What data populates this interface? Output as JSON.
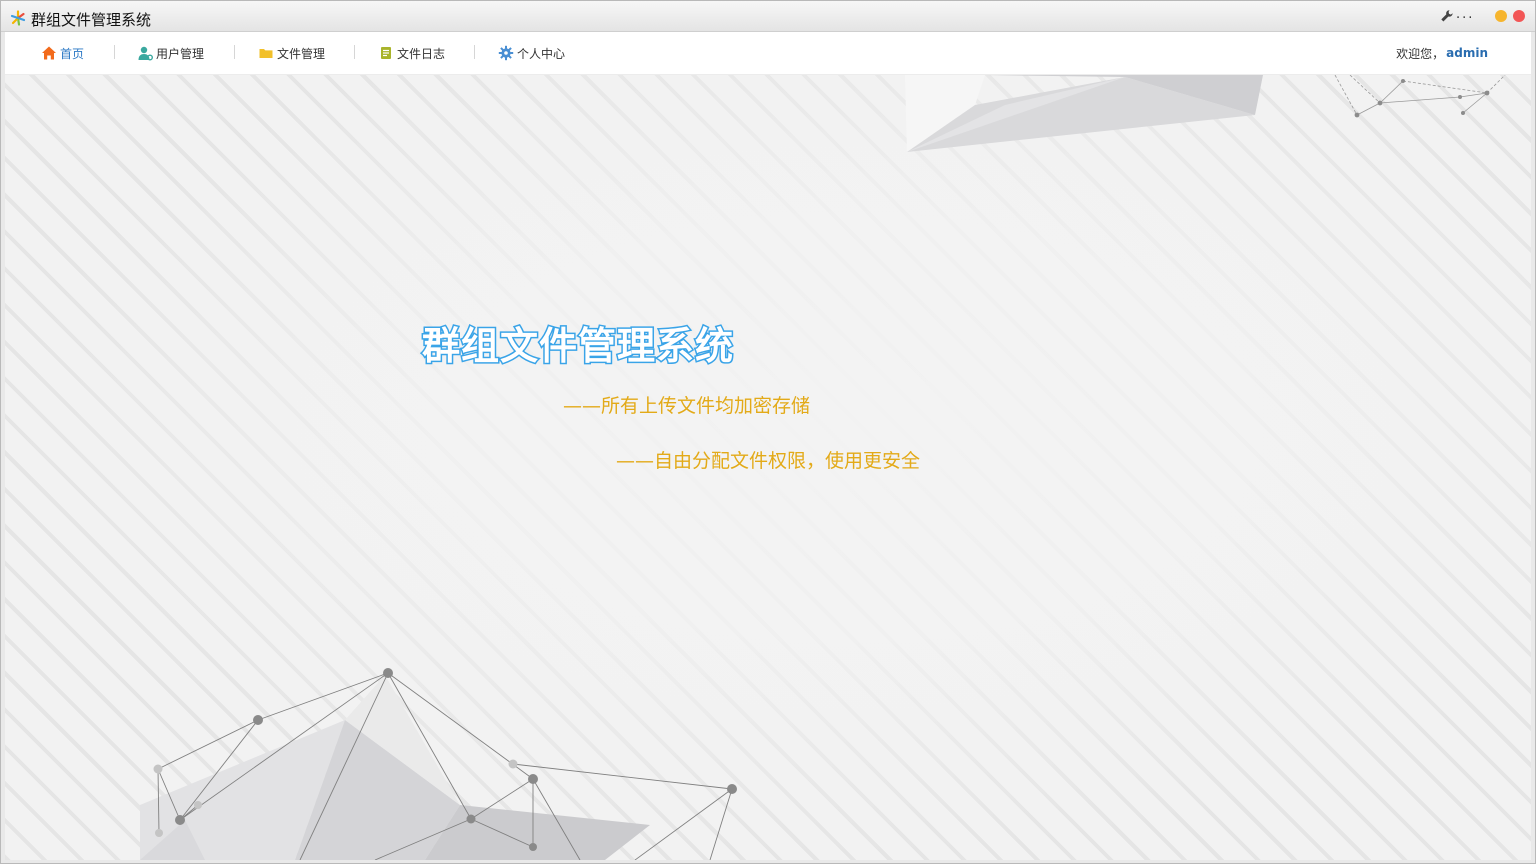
{
  "window": {
    "title": "群组文件管理系统",
    "more_label": "...",
    "app_icon": "pinwheel-icon",
    "controls": {
      "minimize_color": "#f6b52e",
      "close_color": "#f25656"
    }
  },
  "nav": {
    "items": [
      {
        "label": "首页",
        "icon": "home-icon",
        "active": true
      },
      {
        "label": "用户管理",
        "icon": "user-icon",
        "active": false
      },
      {
        "label": "文件管理",
        "icon": "folder-icon",
        "active": false
      },
      {
        "label": "文件日志",
        "icon": "log-icon",
        "active": false
      },
      {
        "label": "个人中心",
        "icon": "gear-icon",
        "active": false
      }
    ],
    "welcome_prefix": "欢迎您，",
    "username": "admin"
  },
  "hero": {
    "title": "群组文件管理系统",
    "slogan_1": "——所有上传文件均加密存储",
    "slogan_2": "——自由分配文件权限，使用更安全"
  },
  "colors": {
    "title_stroke": "#3aa4e8",
    "slogan": "#e3aa18",
    "active_nav": "#2b78c5",
    "username": "#2a6db0"
  }
}
